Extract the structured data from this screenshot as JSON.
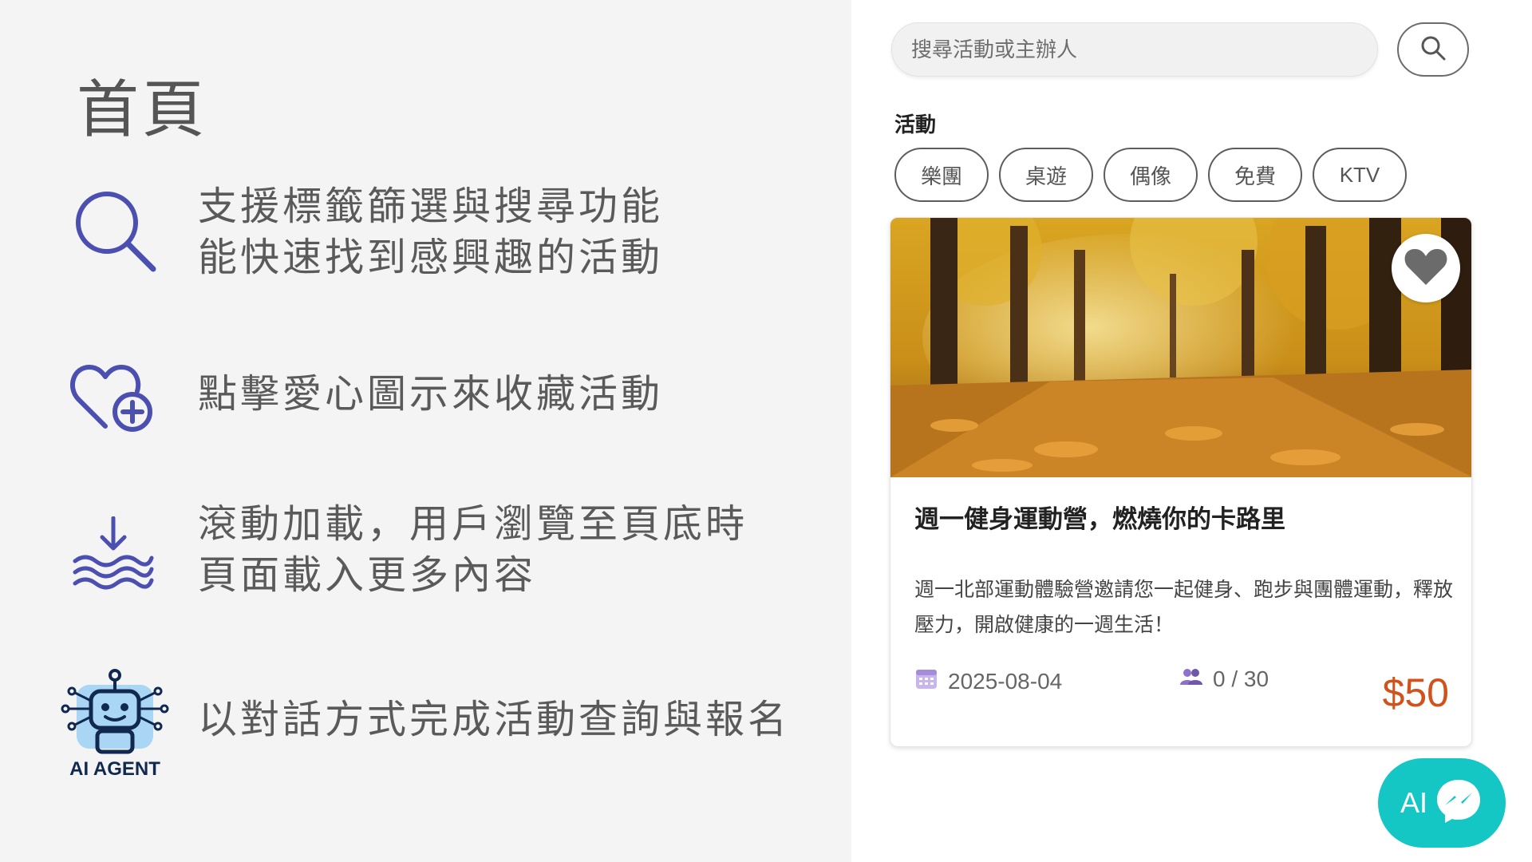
{
  "slide": {
    "title": "首頁",
    "features": [
      {
        "icon": "search-icon",
        "lines": [
          "支援標籤篩選與搜尋功能",
          "能快速找到感興趣的活動"
        ]
      },
      {
        "icon": "heart-plus-icon",
        "lines": [
          "點擊愛心圖示來收藏活動"
        ]
      },
      {
        "icon": "scroll-load-icon",
        "lines": [
          "滾動加載，用戶瀏覽至頁底時",
          "頁面載入更多內容"
        ]
      },
      {
        "icon": "robot-icon",
        "lines": [
          "以對話方式完成活動查詢與報名"
        ],
        "badge": "AI AGENT"
      }
    ]
  },
  "app": {
    "search": {
      "placeholder": "搜尋活動或主辦人"
    },
    "section_label": "活動",
    "tags": [
      "樂團",
      "桌遊",
      "偶像",
      "免費",
      "KTV"
    ],
    "card": {
      "title": "週一健身運動營，燃燒你的卡路里",
      "description": "週一北部運動體驗營邀請您一起健身、跑步與團體運動，釋放壓力，開啟健康的一週生活！",
      "date": "2025-08-04",
      "participants": "0 / 30",
      "price": "$50"
    },
    "ai_button": {
      "label": "AI"
    }
  },
  "colors": {
    "icon_purple": "#4b4fb0",
    "price_orange": "#d2521b",
    "fab_teal": "#14c7c4",
    "left_bg": "#f4f4f4"
  }
}
